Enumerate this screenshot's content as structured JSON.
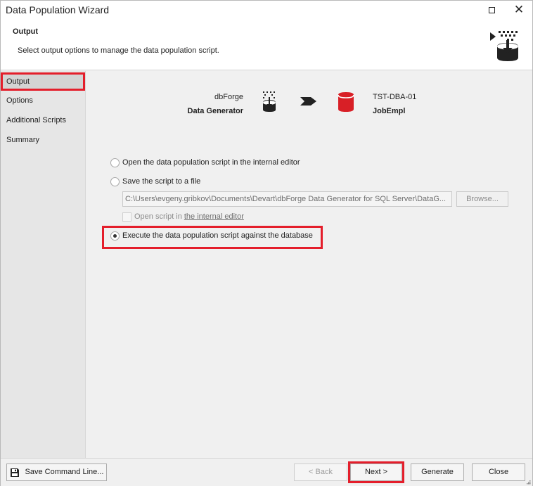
{
  "window": {
    "title": "Data Population Wizard"
  },
  "header": {
    "title": "Output",
    "description": "Select output options to manage the data population script.",
    "icon": "data-population-icon"
  },
  "sidebar": {
    "items": [
      {
        "label": "Output",
        "active": true
      },
      {
        "label": "Options"
      },
      {
        "label": "Additional Scripts"
      },
      {
        "label": "Summary"
      }
    ]
  },
  "flow": {
    "source_line1": "dbForge",
    "source_line2": "Data Generator",
    "target_line1": "TST-DBA-01",
    "target_line2": "JobEmpl"
  },
  "options": {
    "open_in_editor": "Open the data population script in the internal editor",
    "save_to_file": "Save the script to a file",
    "file_path": "C:\\Users\\evgeny.gribkov\\Documents\\Devart\\dbForge Data Generator for SQL Server\\DataG...",
    "browse_label": "Browse...",
    "open_script_prefix": "Open script in",
    "open_script_link": "the internal editor",
    "execute": "Execute the data population script against the database",
    "selected": "execute"
  },
  "footer": {
    "save_command_line": "Save Command Line...",
    "back": "< Back",
    "next": "Next >",
    "generate": "Generate",
    "close": "Close"
  },
  "colors": {
    "highlight": "#e41e2b",
    "db_red": "#d81f26"
  }
}
